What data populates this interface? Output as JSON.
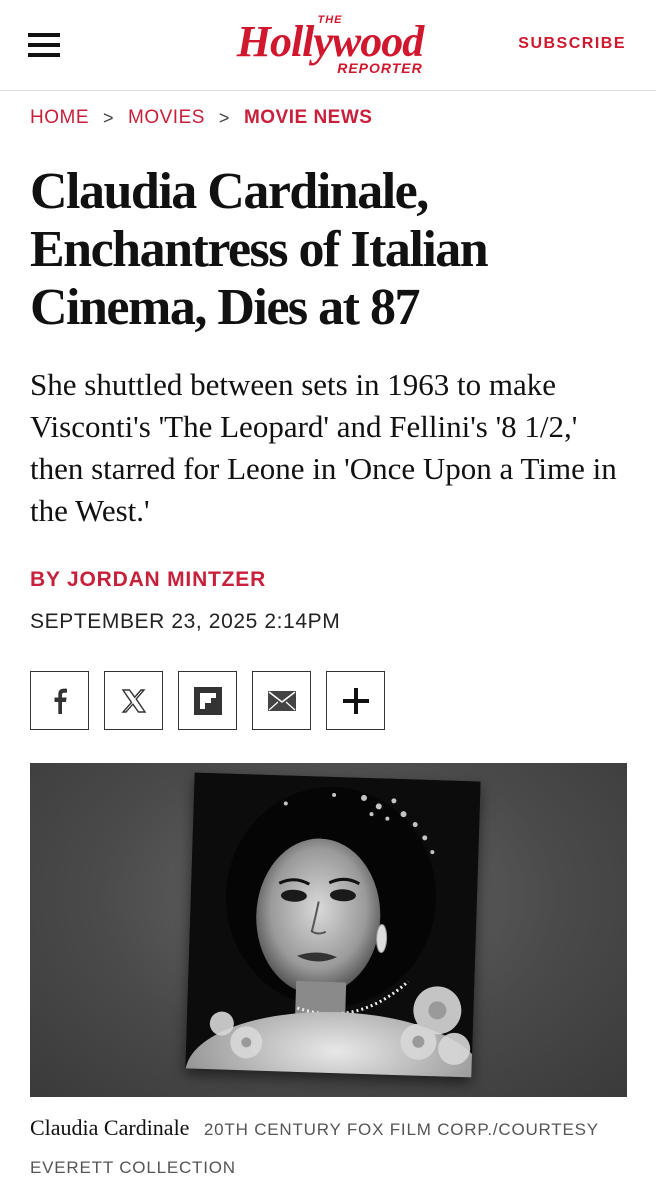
{
  "header": {
    "logo_the": "THE",
    "logo_main": "Hollywood",
    "logo_reporter": "REPORTER",
    "subscribe_label": "SUBSCRIBE",
    "brand_color": "#d1172e"
  },
  "breadcrumb": {
    "items": [
      "HOME",
      "MOVIES",
      "MOVIE NEWS"
    ],
    "separator": ">"
  },
  "article": {
    "title": "Claudia Cardinale, Enchantress of Italian Cinema, Dies at 87",
    "dek": "She shuttled between sets in 1963 to make Visconti's 'The Leopard' and Fellini's '8 1/2,' then starred for Leone in 'Once Upon a Time in the West.'",
    "byline": "BY JORDAN MINTZER",
    "date": "SEPTEMBER 23, 2025 2:14PM"
  },
  "share": {
    "buttons": [
      "facebook-icon",
      "x-icon",
      "flipboard-icon",
      "email-icon",
      "plus-icon"
    ]
  },
  "image": {
    "caption_name": "Claudia Cardinale",
    "caption_credit": "20TH CENTURY FOX FILM CORP./COURTESY EVERETT COLLECTION"
  }
}
